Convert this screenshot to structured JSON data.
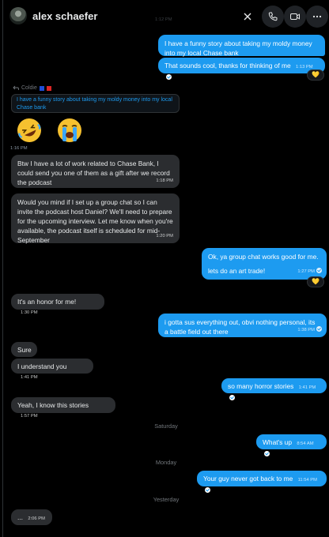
{
  "header": {
    "username": "alex schaefer",
    "icons": [
      "close-icon",
      "phone-icon",
      "video-icon",
      "more-icon"
    ],
    "faded_ts": "1:12 PM"
  },
  "colors": {
    "outgoing": "#1d9bf0",
    "incoming": "#2b2d30",
    "background": "#000000"
  },
  "reply": {
    "author": "Coldie",
    "quote": "I have a funny story about taking my moldy money into my local Chase bank",
    "emojis": [
      "rolling-on-floor-laughing-emoji",
      "loudly-crying-emoji"
    ],
    "time": "1:16 PM"
  },
  "messages": [
    {
      "id": "m1",
      "dir": "out",
      "text": "I have a funny story about taking my moldy money into my local Chase bank",
      "time": ""
    },
    {
      "id": "m2",
      "dir": "out",
      "text": "That sounds cool, thanks for thinking of me",
      "time": "1:13 PM",
      "reaction": "heart"
    },
    {
      "id": "m3",
      "dir": "in",
      "text": "Btw I have a lot of work related to Chase Bank, I could send you one of them as a gift after we record the podcast",
      "time": "1:18 PM"
    },
    {
      "id": "m4",
      "dir": "in",
      "text": "Would you mind if I set up a group chat so I can invite the podcast host Daniel? We'll need to prepare for the upcoming interview. Let me know when you're available, the podcast itself is scheduled for mid-September",
      "time": "1:20 PM"
    },
    {
      "id": "m5",
      "dir": "out",
      "text": "Ok, ya group chat works good for me.",
      "text2": "lets do an art trade!",
      "time": "1:27 PM",
      "reaction": "heart"
    },
    {
      "id": "m6",
      "dir": "in",
      "text": "It's an honor for me!",
      "time": "1:30 PM"
    },
    {
      "id": "m7",
      "dir": "out",
      "text": "i gotta sus everything out, obvi nothing personal, its a battle field out there",
      "time": "1:38 PM"
    },
    {
      "id": "m8",
      "dir": "in",
      "text": "Sure",
      "time": ""
    },
    {
      "id": "m9",
      "dir": "in",
      "text": "I understand you",
      "time": "1:41 PM"
    },
    {
      "id": "m10",
      "dir": "out",
      "text": "so many horror stories",
      "time": "1:41 PM"
    },
    {
      "id": "m11",
      "dir": "in",
      "text": "Yeah, I know this stories",
      "time": "1:57 PM"
    },
    {
      "id": "m12",
      "dir": "out",
      "text": "What's up",
      "time": "8:54 AM"
    },
    {
      "id": "m13",
      "dir": "out",
      "text": "Your guy never got back to me",
      "time": "11:54 PM"
    },
    {
      "id": "m14",
      "dir": "in",
      "text": "...",
      "time": "2:06 PM"
    }
  ],
  "days": {
    "d1": "Saturday",
    "d2": "Monday",
    "d3": "Yesterday"
  }
}
